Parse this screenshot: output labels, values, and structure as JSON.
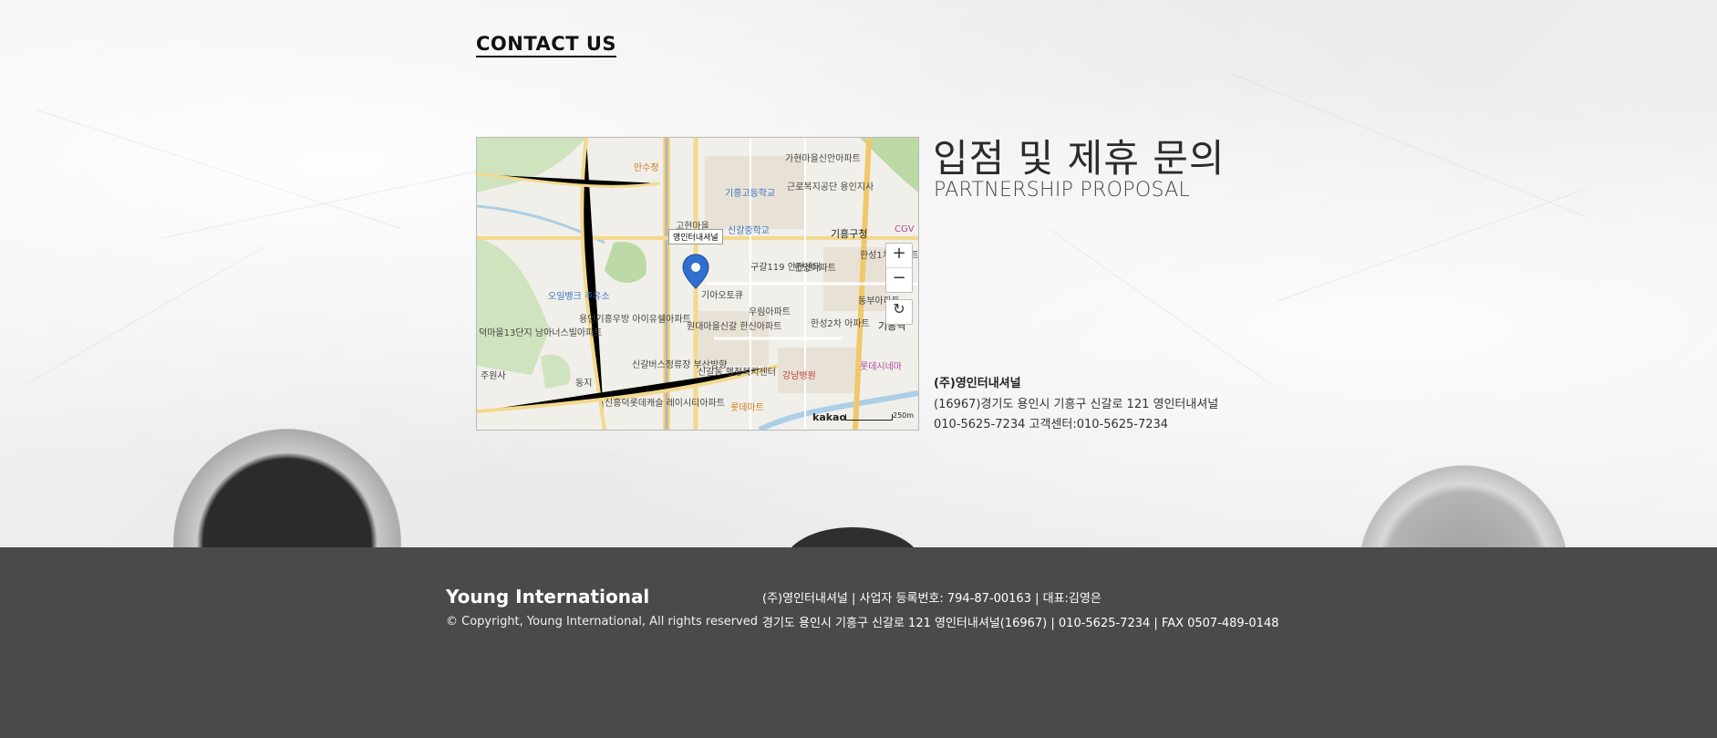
{
  "contact": {
    "title": "CONTACT US"
  },
  "map": {
    "pin_label": "영인터내셔널",
    "labels": [
      "가현마을신안아파트",
      "근로복지공단 용인지사",
      "기흥고등학교",
      "신갈중학교",
      "기흥구청",
      "CGV",
      "고현마을",
      "구갈119 안전센터",
      "한양아파트",
      "한성1차 아파트",
      "동부아파트",
      "기아오토큐",
      "우림아파트",
      "한성2차 아파트",
      "기흥역",
      "오일뱅크 주유소",
      "용인기흥우방 아이유쉘아파트",
      "원대마을신갈 한신아파트",
      "신갈버스정류장 부산방향",
      "신갈동 행정복지센터",
      "강남병원",
      "롯데시네마",
      "신흥덕롯데캐슬 레이시티아파트",
      "롯데마트",
      "덕마을13단지 남아너스빌아파트",
      "주원사",
      "동지",
      "만수정"
    ],
    "brand": "kakao",
    "scale": "250m",
    "zoom_in": "+",
    "zoom_out": "−",
    "refresh": "↻"
  },
  "partnership": {
    "heading_ko": "입점 및 제휴 문의",
    "heading_en": "PARTNERSHIP PROPOSAL",
    "company": "(주)영인터내셔널",
    "address": "(16967)경기도 용인시 기흥구 신갈로 121 영인터내셔널",
    "phones": "010-5625-7234 고객센터:010-5625-7234"
  },
  "footer": {
    "brand": "Young International",
    "copyright": "© Copyright, Young International, All rights reserved",
    "line1": "(주)영인터내셔널 | 사업자 등록번호: 794-87-00163 | 대표:김영은",
    "line2": "경기도 용인시 기흥구 신갈로 121 영인터내셔널(16967) | 010-5625-7234 | FAX 0507-489-0148"
  }
}
